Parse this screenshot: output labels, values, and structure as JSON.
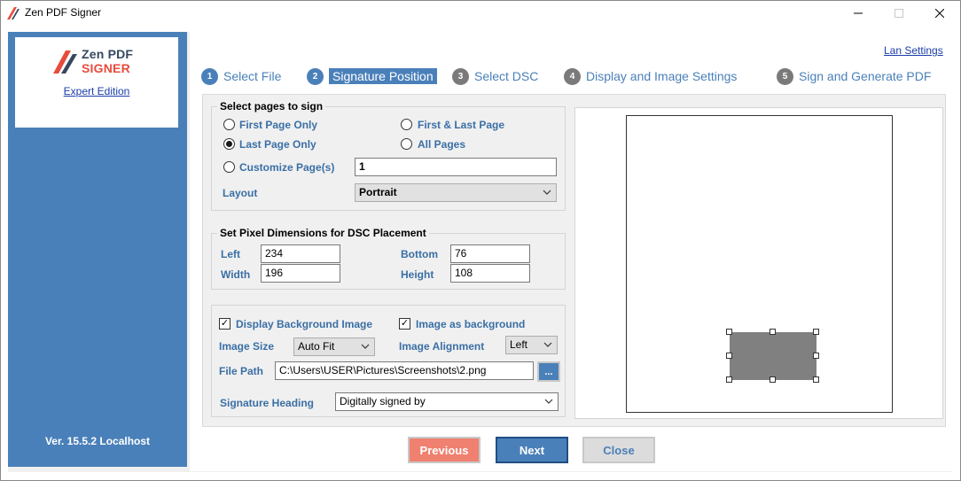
{
  "window": {
    "title": "Zen PDF Signer"
  },
  "brand": {
    "line1": "Zen PDF",
    "line2": "SIGNER",
    "edition_link": "Expert Edition",
    "version": "Ver. 15.5.2 Localhost"
  },
  "header": {
    "lan_settings": "Lan Settings"
  },
  "steps": [
    {
      "num": "1",
      "label": "Select File"
    },
    {
      "num": "2",
      "label": "Signature Position"
    },
    {
      "num": "3",
      "label": "Select DSC"
    },
    {
      "num": "4",
      "label": "Display and Image Settings"
    },
    {
      "num": "5",
      "label": "Sign and Generate PDF"
    }
  ],
  "pages_group": {
    "title": "Select pages to sign",
    "options": {
      "first_page_only": "First Page Only",
      "first_last_page": "First & Last Page",
      "last_page_only": "Last Page Only",
      "all_pages": "All Pages",
      "customize_pages": "Customize Page(s)"
    },
    "selected": "last_page_only",
    "customize_value": "1",
    "layout_label": "Layout",
    "layout_value": "Portrait"
  },
  "dims_group": {
    "title": "Set Pixel Dimensions for DSC Placement",
    "left_label": "Left",
    "left_value": "234",
    "width_label": "Width",
    "width_value": "196",
    "bottom_label": "Bottom",
    "bottom_value": "76",
    "height_label": "Height",
    "height_value": "108"
  },
  "image_group": {
    "display_bg_label": "Display Background Image",
    "display_bg_checked": true,
    "image_as_bg_label": "Image as background",
    "image_as_bg_checked": true,
    "image_size_label": "Image Size",
    "image_size_value": "Auto Fit",
    "image_alignment_label": "Image Alignment",
    "image_alignment_value": "Left",
    "file_path_label": "File Path",
    "file_path_value": "C:\\Users\\USER\\Pictures\\Screenshots\\2.png",
    "browse_label": "...",
    "signature_heading_label": "Signature Heading",
    "signature_heading_value": "Digitally signed by"
  },
  "buttons": {
    "previous": "Previous",
    "next": "Next",
    "close": "Close"
  },
  "colors": {
    "accent": "#4a80b9",
    "previous": "#f0806f",
    "label": "#3a6fa5"
  }
}
